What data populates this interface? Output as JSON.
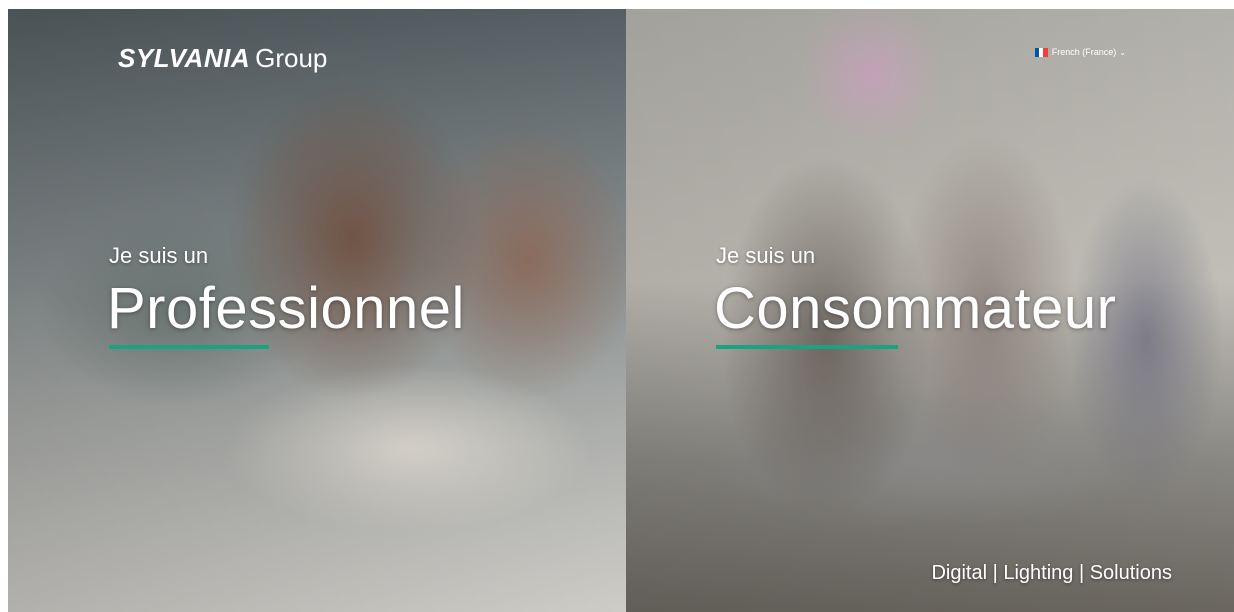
{
  "brand": {
    "name": "SYLVANIA",
    "suffix": "Group"
  },
  "language": {
    "flag_colors": [
      "#0055A4",
      "#FFFFFF",
      "#EF4135"
    ],
    "label": "French (France)",
    "chevron": "⌄"
  },
  "panels": {
    "professional": {
      "lead": "Je suis un",
      "title": "Professionnel"
    },
    "consumer": {
      "lead": "Je suis un",
      "title": "Consommateur"
    }
  },
  "tagline": "Digital | Lighting | Solutions",
  "theme": {
    "accent": "#1aa37f",
    "text": "#ffffff"
  }
}
